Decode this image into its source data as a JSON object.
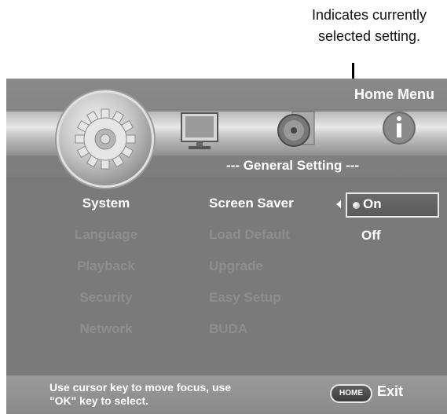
{
  "callout": {
    "line1": "Indicates currently",
    "line2": "selected setting."
  },
  "header": {
    "title": "Home Menu"
  },
  "icons": [
    "gear-icon",
    "monitor-icon",
    "music-icon",
    "info-icon"
  ],
  "section": {
    "title": "--- General Setting ---"
  },
  "categories": [
    {
      "label": "System",
      "active": true
    },
    {
      "label": "Language",
      "active": false
    },
    {
      "label": "Playback",
      "active": false
    },
    {
      "label": "Security",
      "active": false
    },
    {
      "label": "Network",
      "active": false
    }
  ],
  "options": [
    {
      "label": "Screen Saver",
      "active": true
    },
    {
      "label": "Load Default",
      "active": false
    },
    {
      "label": "Upgrade",
      "active": false
    },
    {
      "label": "Easy Setup",
      "active": false
    },
    {
      "label": "BUDA",
      "active": false
    }
  ],
  "values": {
    "selected": "On",
    "other": "Off"
  },
  "footer": {
    "hint_line1": "Use cursor key to move focus, use",
    "hint_line2": "\"OK\" key to select.",
    "home_key": "HOME",
    "exit_label": "Exit"
  },
  "colors": {
    "active_text": "#ffffff",
    "inactive_text": "#8e8e8e",
    "panel_bg": "#7a7a7a"
  }
}
